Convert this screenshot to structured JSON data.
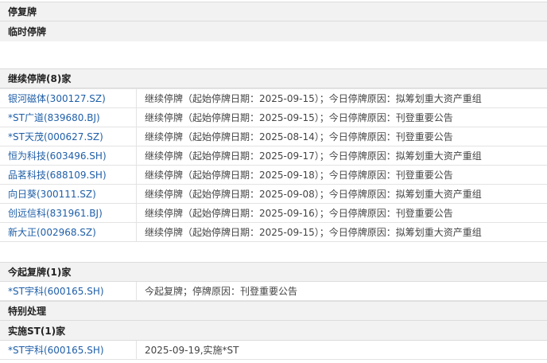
{
  "sections": {
    "main_title": "停复牌",
    "temp_halt_title": "临时停牌",
    "continue_title": "继续停牌(8)家",
    "resume_title": "今起复牌(1)家",
    "special_title": "特别处理",
    "st_title": "实施ST(1)家"
  },
  "continue_rows": [
    {
      "name": "银河磁体(300127.SZ)",
      "desc": "继续停牌（起始停牌日期：2025-09-15）；今日停牌原因：拟筹划重大资产重组"
    },
    {
      "name": "*ST广道(839680.BJ)",
      "desc": "继续停牌（起始停牌日期：2025-09-15）；今日停牌原因：刊登重要公告"
    },
    {
      "name": "*ST天茂(000627.SZ)",
      "desc": "继续停牌（起始停牌日期：2025-08-14）；今日停牌原因：刊登重要公告"
    },
    {
      "name": "恒为科技(603496.SH)",
      "desc": "继续停牌（起始停牌日期：2025-09-17）；今日停牌原因：拟筹划重大资产重组"
    },
    {
      "name": "品茗科技(688109.SH)",
      "desc": "继续停牌（起始停牌日期：2025-09-18）；今日停牌原因：刊登重要公告"
    },
    {
      "name": "向日葵(300111.SZ)",
      "desc": "继续停牌（起始停牌日期：2025-09-08）；今日停牌原因：拟筹划重大资产重组"
    },
    {
      "name": "创远信科(831961.BJ)",
      "desc": "继续停牌（起始停牌日期：2025-09-16）；今日停牌原因：刊登重要公告"
    },
    {
      "name": "新大正(002968.SZ)",
      "desc": "继续停牌（起始停牌日期：2025-09-15）；今日停牌原因：拟筹划重大资产重组"
    }
  ],
  "resume_rows": [
    {
      "name": "*ST宇科(600165.SH)",
      "desc": "今起复牌；停牌原因：刊登重要公告"
    }
  ],
  "st_rows": [
    {
      "name": "*ST宇科(600165.SH)",
      "desc": "2025-09-19,实施*ST"
    }
  ]
}
